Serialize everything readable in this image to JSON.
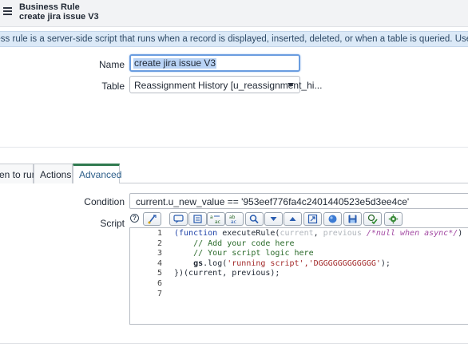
{
  "header": {
    "record_type": "Business Rule",
    "record_title": "create jira issue V3"
  },
  "info_banner": {
    "text": "ness rule is a server-side script that runs when a record is displayed, inserted, deleted, or when a table is queried. Use business rules to aut"
  },
  "form": {
    "name_label": "Name",
    "name_value": "create jira issue V3",
    "table_label": "Table",
    "table_value": "Reassignment History [u_reassignment_hi..."
  },
  "tabs": [
    {
      "label": "en to run"
    },
    {
      "label": "Actions"
    },
    {
      "label": "Advanced"
    }
  ],
  "advanced": {
    "condition_label": "Condition",
    "condition_value": "current.u_new_value == '953eef776fa4c2401440523e5d3ee4ce'",
    "script_label": "Script",
    "help_glyph": "?",
    "toolbar_icons": [
      "comment-icon",
      "format-icon",
      "replace-icon",
      "replace-all-icon",
      "search-icon",
      "find-next-icon",
      "find-prev-icon",
      "fullscreen-icon",
      "help-globe-icon",
      "save-icon",
      "syntax-check-icon",
      "settings-gear-icon"
    ],
    "line_numbers": [
      "1",
      "2",
      "3",
      "4",
      "5",
      "6",
      "7"
    ],
    "code": {
      "l1_kw": "(function",
      "l1_fn": " executeRule(",
      "l1_cur": "current",
      "l1_sep": ", ",
      "l1_prev": "previous",
      "l1_cmt": " /*null when async*/",
      "l1_end": ") {",
      "l2": "    // Add your code here",
      "l3": "    // Your script logic here",
      "l4_indent": "    ",
      "l4_gs": "gs",
      "l4_log": ".log(",
      "l4_str": "'running script','DGGGGGGGGGGGG'",
      "l4_end": ");",
      "l5": "})(current, previous);"
    }
  }
}
